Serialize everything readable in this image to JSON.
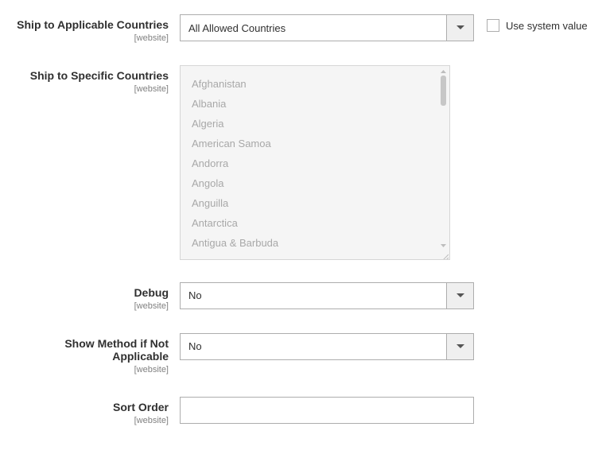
{
  "fields": {
    "ship_applicable": {
      "label": "Ship to Applicable Countries",
      "scope": "[website]",
      "value": "All Allowed Countries",
      "use_system_label": "Use system value"
    },
    "ship_specific": {
      "label": "Ship to Specific Countries",
      "scope": "[website]",
      "options": [
        "Afghanistan",
        "Albania",
        "Algeria",
        "American Samoa",
        "Andorra",
        "Angola",
        "Anguilla",
        "Antarctica",
        "Antigua & Barbuda"
      ]
    },
    "debug": {
      "label": "Debug",
      "scope": "[website]",
      "value": "No"
    },
    "show_method": {
      "label": "Show Method if Not Applicable",
      "scope": "[website]",
      "value": "No"
    },
    "sort_order": {
      "label": "Sort Order",
      "scope": "[website]",
      "value": ""
    }
  }
}
